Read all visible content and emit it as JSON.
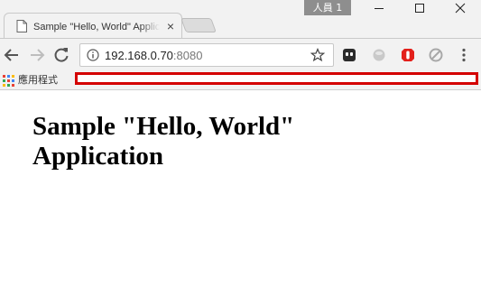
{
  "tab": {
    "title": "Sample \"Hello, World\" Application",
    "close_glyph": "×"
  },
  "profile": {
    "label": "人員 1"
  },
  "window_controls": {
    "minimize": "–",
    "maximize": "□",
    "close": "✕"
  },
  "toolbar": {
    "url_host": "192.168.0.70",
    "url_port": ":8080"
  },
  "icons": {
    "document": "document-icon",
    "back": "back-arrow-icon",
    "forward": "forward-arrow-icon",
    "reload": "reload-icon",
    "info": "info-icon",
    "star": "bookmark-star-icon",
    "ext1": "ghostery-extension-icon",
    "ext2": "grey-sphere-extension-icon",
    "ext3": "red-shield-extension-icon",
    "ext4": "grey-blocked-extension-icon",
    "menu": "three-dot-menu-icon",
    "apps": "apps-grid-icon"
  },
  "colors": {
    "highlight_border": "#d40000",
    "chrome_bg": "#f2f2f2"
  },
  "bookmarks": {
    "apps_label": "應用程式"
  },
  "page": {
    "heading": "Sample \"Hello, World\" Application"
  }
}
